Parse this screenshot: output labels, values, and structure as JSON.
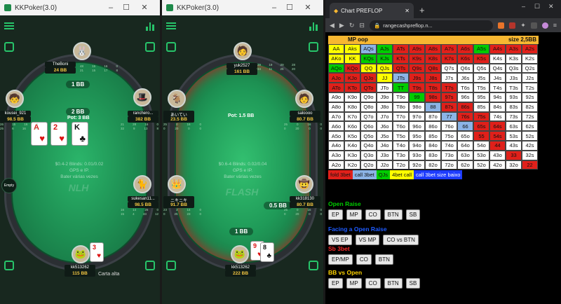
{
  "window1": {
    "title": "KKPoker(3.0)",
    "bb_label": "1 BB",
    "pot_bet": "2 BB",
    "pot": "Pot: 3 BB",
    "info_line1": "$0.4-2   Blinds: 0.01/0.02",
    "info_line2": "GPS e IP.",
    "info_line3": "Bater várias vezes",
    "brand": "NLH",
    "empty_label": "Empty",
    "carta_alta": "Carta alta",
    "players": [
      {
        "name": "TheBoni",
        "stack": "24 BB",
        "avatar": "🐰",
        "stats": [
          "48",
          "15",
          "16",
          "0",
          "21",
          "15",
          "17",
          "8"
        ]
      },
      {
        "name": "kousei_921",
        "stack": "98.5 BB",
        "avatar": "🧒",
        "stats": [
          "26",
          "15",
          "16",
          "0",
          "25",
          "6",
          "16",
          "40"
        ]
      },
      {
        "name": "ranchero...",
        "stack": "382 BB",
        "avatar": "🎩",
        "stats": [
          "21",
          "28",
          "16",
          "0",
          "32",
          "9",
          "13",
          "8"
        ]
      },
      {
        "name": "sukesan11...",
        "stack": "98.5 BB",
        "avatar": "🐈",
        "stats": [
          "16",
          "14",
          "26",
          "0",
          "15",
          "4",
          "33",
          "12"
        ]
      },
      {
        "name": "kk513262",
        "stack": "115 BB",
        "avatar": "🐸",
        "stats": []
      }
    ],
    "hole_cards": [
      {
        "rank": "A",
        "suit": "♥"
      },
      {
        "rank": "2",
        "suit": "♥"
      },
      {
        "rank": "K",
        "suit": "♣"
      }
    ],
    "hero_cards": [
      {
        "rank": "3",
        "suit": "♥"
      }
    ]
  },
  "window2": {
    "title": "KKPoker(3.0)",
    "pot": "Pot: 1.5 BB",
    "info_line1": "$0.6-4   Blinds: 0.02/0.04",
    "info_line2": "GPS e IP.",
    "info_line3": "Bater várias vezes",
    "brand": "FLASH",
    "bb_label": "1 BB",
    "half_bb": "0.5 BB",
    "players": [
      {
        "name": "yuk2527",
        "stack": "161 BB",
        "avatar": "🧑",
        "stats": [
          "39",
          "19",
          "29",
          "28",
          "34",
          "11",
          "25",
          "20"
        ]
      },
      {
        "name": "あいてい",
        "stack": "23.5 BB",
        "avatar": "🐐",
        "stats": [
          "25",
          "0",
          "16",
          "0",
          "0",
          "20",
          "0",
          "0"
        ]
      },
      {
        "name": "saloooo",
        "stack": "80.7 BB",
        "avatar": "🧑",
        "stats": [
          "25",
          "0",
          "16",
          "0",
          "0",
          "20",
          "0",
          "0"
        ]
      },
      {
        "name": "ニキニキ",
        "stack": "91.7 BB",
        "avatar": "👑",
        "stats": [
          "23",
          "3",
          "14",
          "0",
          "0",
          "25",
          "23",
          "0"
        ]
      },
      {
        "name": "kk318130",
        "stack": "80.7 BB",
        "avatar": "🤠",
        "stats": [
          "25",
          "0",
          "16",
          "0",
          "0",
          "20",
          "0",
          "0"
        ]
      },
      {
        "name": "kk513262",
        "stack": "222 BB",
        "avatar": "🐸",
        "stats": []
      }
    ],
    "hero_cards": [
      {
        "rank": "9",
        "suit": "♥"
      },
      {
        "rank": "8",
        "suit": "♣"
      }
    ]
  },
  "browser": {
    "tab_title": "Chart PREFLOP",
    "url": "rangecashpreflop.n...",
    "range_title": "MP oop",
    "size_label": "size 2,5BB",
    "colors": {
      "yellow": "#ffff00",
      "green": "#00cc00",
      "red": "#e0201a",
      "blue": "#8cb4e6",
      "white": "#ffffff",
      "orange": "#f7b731"
    },
    "grid": [
      [
        [
          "AA",
          "y"
        ],
        [
          "Aks",
          "y"
        ],
        [
          "AQs",
          "b"
        ],
        [
          "AJs",
          "g"
        ],
        [
          "ATs",
          "r"
        ],
        [
          "A9s",
          "r"
        ],
        [
          "A8s",
          "r"
        ],
        [
          "A7s",
          "r"
        ],
        [
          "A6s",
          "r"
        ],
        [
          "A5s",
          "g"
        ],
        [
          "A4s",
          "r"
        ],
        [
          "A3s",
          "r"
        ],
        [
          "A2s",
          "r"
        ]
      ],
      [
        [
          "AKo",
          "y"
        ],
        [
          "KK",
          "y"
        ],
        [
          "KQs",
          "g"
        ],
        [
          "KJs",
          "g"
        ],
        [
          "KTs",
          "r"
        ],
        [
          "K9s",
          "r"
        ],
        [
          "K8s",
          "r"
        ],
        [
          "K7s",
          "r"
        ],
        [
          "K6s",
          "r"
        ],
        [
          "K5s",
          "r"
        ],
        [
          "K4s",
          "w"
        ],
        [
          "K3s",
          "w"
        ],
        [
          "K2s",
          "w"
        ]
      ],
      [
        [
          "AQo",
          "g"
        ],
        [
          "KQo",
          "r"
        ],
        [
          "QQ",
          "y"
        ],
        [
          "QJs",
          "y"
        ],
        [
          "QTs",
          "r"
        ],
        [
          "Q9s",
          "r"
        ],
        [
          "Q8s",
          "r"
        ],
        [
          "Q7s",
          "w"
        ],
        [
          "Q6s",
          "w"
        ],
        [
          "Q5s",
          "w"
        ],
        [
          "Q4s",
          "w"
        ],
        [
          "Q3s",
          "w"
        ],
        [
          "Q2s",
          "w"
        ]
      ],
      [
        [
          "AJo",
          "r"
        ],
        [
          "KJo",
          "r"
        ],
        [
          "QJo",
          "r"
        ],
        [
          "JJ",
          "y"
        ],
        [
          "JTs",
          "b"
        ],
        [
          "J9s",
          "r"
        ],
        [
          "J8s",
          "r"
        ],
        [
          "J7s",
          "w"
        ],
        [
          "J6s",
          "w"
        ],
        [
          "J5s",
          "w"
        ],
        [
          "J4s",
          "w"
        ],
        [
          "J3s",
          "w"
        ],
        [
          "J2s",
          "w"
        ]
      ],
      [
        [
          "ATo",
          "r"
        ],
        [
          "KTo",
          "r"
        ],
        [
          "QTo",
          "r"
        ],
        [
          "JTo",
          "w"
        ],
        [
          "TT",
          "g"
        ],
        [
          "T9s",
          "r"
        ],
        [
          "T8s",
          "r"
        ],
        [
          "T7s",
          "r"
        ],
        [
          "T6s",
          "w"
        ],
        [
          "T5s",
          "w"
        ],
        [
          "T4s",
          "w"
        ],
        [
          "T3s",
          "w"
        ],
        [
          "T2s",
          "w"
        ]
      ],
      [
        [
          "A9o",
          "w"
        ],
        [
          "K9o",
          "w"
        ],
        [
          "Q9o",
          "w"
        ],
        [
          "J9o",
          "w"
        ],
        [
          "T9o",
          "w"
        ],
        [
          "99",
          "g"
        ],
        [
          "98s",
          "r"
        ],
        [
          "97s",
          "r"
        ],
        [
          "96s",
          "w"
        ],
        [
          "95s",
          "w"
        ],
        [
          "94s",
          "w"
        ],
        [
          "93s",
          "w"
        ],
        [
          "92s",
          "w"
        ]
      ],
      [
        [
          "A8o",
          "w"
        ],
        [
          "K8o",
          "w"
        ],
        [
          "Q8o",
          "w"
        ],
        [
          "J8o",
          "w"
        ],
        [
          "T8o",
          "w"
        ],
        [
          "98o",
          "w"
        ],
        [
          "88",
          "b"
        ],
        [
          "87s",
          "r"
        ],
        [
          "86s",
          "r"
        ],
        [
          "85s",
          "w"
        ],
        [
          "84s",
          "w"
        ],
        [
          "83s",
          "w"
        ],
        [
          "82s",
          "w"
        ]
      ],
      [
        [
          "A7o",
          "w"
        ],
        [
          "K7o",
          "w"
        ],
        [
          "Q7o",
          "w"
        ],
        [
          "J7o",
          "w"
        ],
        [
          "T7o",
          "w"
        ],
        [
          "97o",
          "w"
        ],
        [
          "87o",
          "w"
        ],
        [
          "77",
          "b"
        ],
        [
          "76s",
          "r"
        ],
        [
          "75s",
          "r"
        ],
        [
          "74s",
          "w"
        ],
        [
          "73s",
          "w"
        ],
        [
          "72s",
          "w"
        ]
      ],
      [
        [
          "A6o",
          "w"
        ],
        [
          "K6o",
          "w"
        ],
        [
          "Q6o",
          "w"
        ],
        [
          "J6o",
          "w"
        ],
        [
          "T6o",
          "w"
        ],
        [
          "96o",
          "w"
        ],
        [
          "86o",
          "w"
        ],
        [
          "76o",
          "w"
        ],
        [
          "66",
          "b"
        ],
        [
          "65s",
          "r"
        ],
        [
          "64s",
          "r"
        ],
        [
          "63s",
          "w"
        ],
        [
          "62s",
          "w"
        ]
      ],
      [
        [
          "A5o",
          "w"
        ],
        [
          "K5o",
          "w"
        ],
        [
          "Q5o",
          "w"
        ],
        [
          "J5o",
          "w"
        ],
        [
          "T5o",
          "w"
        ],
        [
          "95o",
          "w"
        ],
        [
          "85o",
          "w"
        ],
        [
          "75o",
          "w"
        ],
        [
          "65o",
          "w"
        ],
        [
          "55",
          "r"
        ],
        [
          "54s",
          "r"
        ],
        [
          "53s",
          "w"
        ],
        [
          "52s",
          "w"
        ]
      ],
      [
        [
          "A4o",
          "w"
        ],
        [
          "K4o",
          "w"
        ],
        [
          "Q4o",
          "w"
        ],
        [
          "J4o",
          "w"
        ],
        [
          "T4o",
          "w"
        ],
        [
          "94o",
          "w"
        ],
        [
          "84o",
          "w"
        ],
        [
          "74o",
          "w"
        ],
        [
          "64o",
          "w"
        ],
        [
          "54o",
          "w"
        ],
        [
          "44",
          "r"
        ],
        [
          "43s",
          "w"
        ],
        [
          "42s",
          "w"
        ]
      ],
      [
        [
          "A3o",
          "w"
        ],
        [
          "K3o",
          "w"
        ],
        [
          "Q3o",
          "w"
        ],
        [
          "J3o",
          "w"
        ],
        [
          "T3o",
          "w"
        ],
        [
          "93o",
          "w"
        ],
        [
          "83o",
          "w"
        ],
        [
          "73o",
          "w"
        ],
        [
          "63o",
          "w"
        ],
        [
          "53o",
          "w"
        ],
        [
          "43o",
          "w"
        ],
        [
          "33",
          "r"
        ],
        [
          "32s",
          "w"
        ]
      ],
      [
        [
          "A2o",
          "w"
        ],
        [
          "K2o",
          "w"
        ],
        [
          "Q2o",
          "w"
        ],
        [
          "J2o",
          "w"
        ],
        [
          "T2o",
          "w"
        ],
        [
          "92o",
          "w"
        ],
        [
          "82o",
          "w"
        ],
        [
          "72o",
          "w"
        ],
        [
          "62o",
          "w"
        ],
        [
          "52o",
          "w"
        ],
        [
          "42o",
          "w"
        ],
        [
          "32o",
          "w"
        ],
        [
          "22",
          "r"
        ]
      ]
    ],
    "legend": [
      {
        "label": "fold 3bet",
        "c": "r"
      },
      {
        "label": "call 3bet",
        "c": "b"
      },
      {
        "label": "QJs",
        "c": "g"
      },
      {
        "label": "4bet call",
        "c": "y"
      },
      {
        "label": "call 3bet size baixo",
        "c": "blue2"
      }
    ],
    "sections": [
      {
        "title": "Open Raise",
        "color": "#00cc00",
        "buttons": [
          "EP",
          "MP",
          "CO",
          "BTN",
          "SB"
        ]
      },
      {
        "title": "Facing a Open Raise",
        "color": "#1e5bff",
        "buttons": [
          "VS EP",
          "VS MP",
          "CO vs BTN"
        ]
      },
      {
        "title": "Sb 3bet",
        "color": "#ff2a2a",
        "buttons": [
          "EP/MP",
          "CO",
          "BTN"
        ]
      },
      {
        "title": "BB vs Open",
        "color": "#ffd400",
        "buttons": [
          "EP",
          "MP",
          "CO",
          "BTN",
          "SB"
        ]
      }
    ]
  }
}
